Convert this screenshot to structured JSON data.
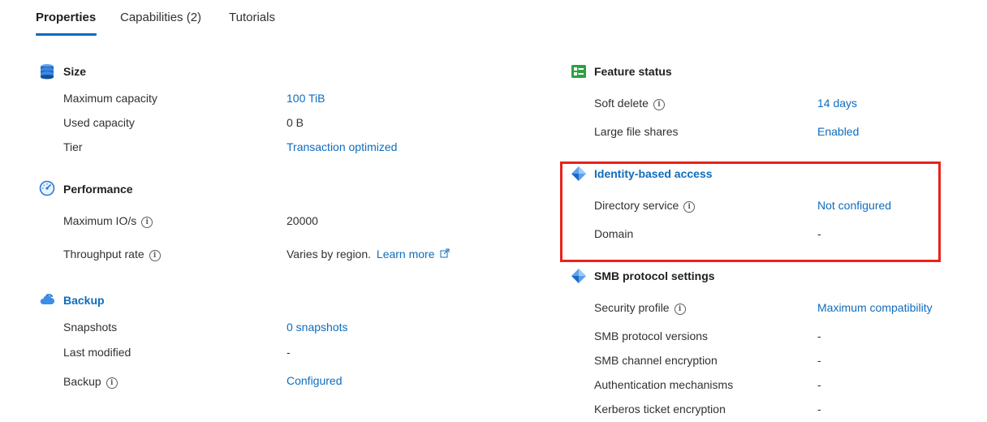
{
  "tabs": [
    "Properties",
    "Capabilities (2)",
    "Tutorials"
  ],
  "size": {
    "title": "Size",
    "rows": [
      {
        "label": "Maximum capacity",
        "value": "100 TiB"
      },
      {
        "label": "Used capacity",
        "value": "0 B"
      },
      {
        "label": "Tier",
        "value": "Transaction optimized"
      }
    ]
  },
  "performance": {
    "title": "Performance",
    "rows": [
      {
        "label": "Maximum IO/s",
        "value": "20000"
      },
      {
        "label": "Throughput rate",
        "value": "Varies by region.",
        "link": "Learn more"
      }
    ]
  },
  "backup": {
    "title": "Backup",
    "rows": [
      {
        "label": "Snapshots",
        "value": "0 snapshots"
      },
      {
        "label": "Last modified",
        "value": "-"
      },
      {
        "label": "Backup",
        "value": "Configured"
      }
    ]
  },
  "feature_status": {
    "title": "Feature status",
    "rows": [
      {
        "label": "Soft delete",
        "value": "14 days"
      },
      {
        "label": "Large file shares",
        "value": "Enabled"
      }
    ]
  },
  "identity": {
    "title": "Identity-based access",
    "rows": [
      {
        "label": "Directory service",
        "value": "Not configured"
      },
      {
        "label": "Domain",
        "value": "-"
      }
    ]
  },
  "smb": {
    "title": "SMB protocol settings",
    "rows": [
      {
        "label": "Security profile",
        "value": "Maximum compatibility"
      },
      {
        "label": "SMB protocol versions",
        "value": "-"
      },
      {
        "label": "SMB channel encryption",
        "value": "-"
      },
      {
        "label": "Authentication mechanisms",
        "value": "-"
      },
      {
        "label": "Kerberos ticket encryption",
        "value": "-"
      }
    ]
  },
  "info_glyph": "i",
  "colors": {
    "accent": "#0f6cbd",
    "highlight": "#e8231c",
    "text": "#323130"
  }
}
